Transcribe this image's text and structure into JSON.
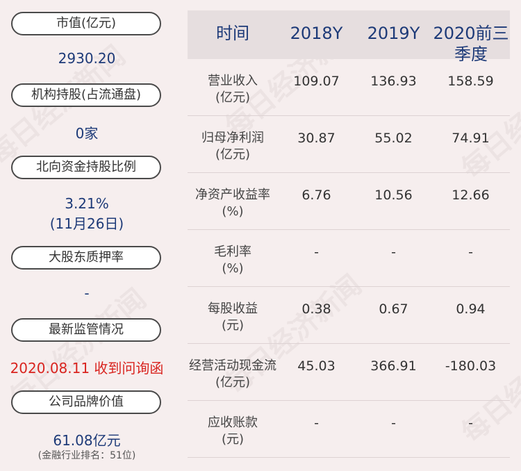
{
  "watermark": "每日经济新闻",
  "left": {
    "items": [
      {
        "label": "市值(亿元)",
        "value": "2930.20"
      },
      {
        "label": "机构持股(占流通盘)",
        "value": "0家"
      },
      {
        "label": "北向资金持股比例",
        "value": "3.21%",
        "value2": "(11月26日)"
      },
      {
        "label": "大股东质押率",
        "value": "-"
      },
      {
        "label": "最新监管情况",
        "value": "2020.08.11 收到问询函"
      },
      {
        "label": "公司品牌价值",
        "value": "61.08亿元",
        "note": "(金融行业排名：51位)"
      }
    ]
  },
  "table": {
    "headers": [
      "时间",
      "2018Y",
      "2019Y",
      "2020前三",
      "季度"
    ],
    "rows": [
      {
        "label1": "营业收入",
        "label2": "(亿元)",
        "values": [
          "109.07",
          "136.93",
          "158.59"
        ]
      },
      {
        "label1": "归母净利润",
        "label2": "(亿元)",
        "values": [
          "30.87",
          "55.02",
          "74.91"
        ]
      },
      {
        "label1": "净资产收益率",
        "label2": "(%)",
        "values": [
          "6.76",
          "10.56",
          "12.66"
        ]
      },
      {
        "label1": "毛利率",
        "label2": "(%)",
        "values": [
          "-",
          "-",
          "-"
        ]
      },
      {
        "label1": "每股收益",
        "label2": "(元)",
        "values": [
          "0.38",
          "0.67",
          "0.94"
        ]
      },
      {
        "label1": "经营活动现金流",
        "label2": "(亿元)",
        "values": [
          "45.03",
          "366.91",
          "-180.03"
        ]
      },
      {
        "label1": "应收账款",
        "label2": "(元)",
        "values": [
          "-",
          "-",
          "-"
        ]
      }
    ]
  }
}
